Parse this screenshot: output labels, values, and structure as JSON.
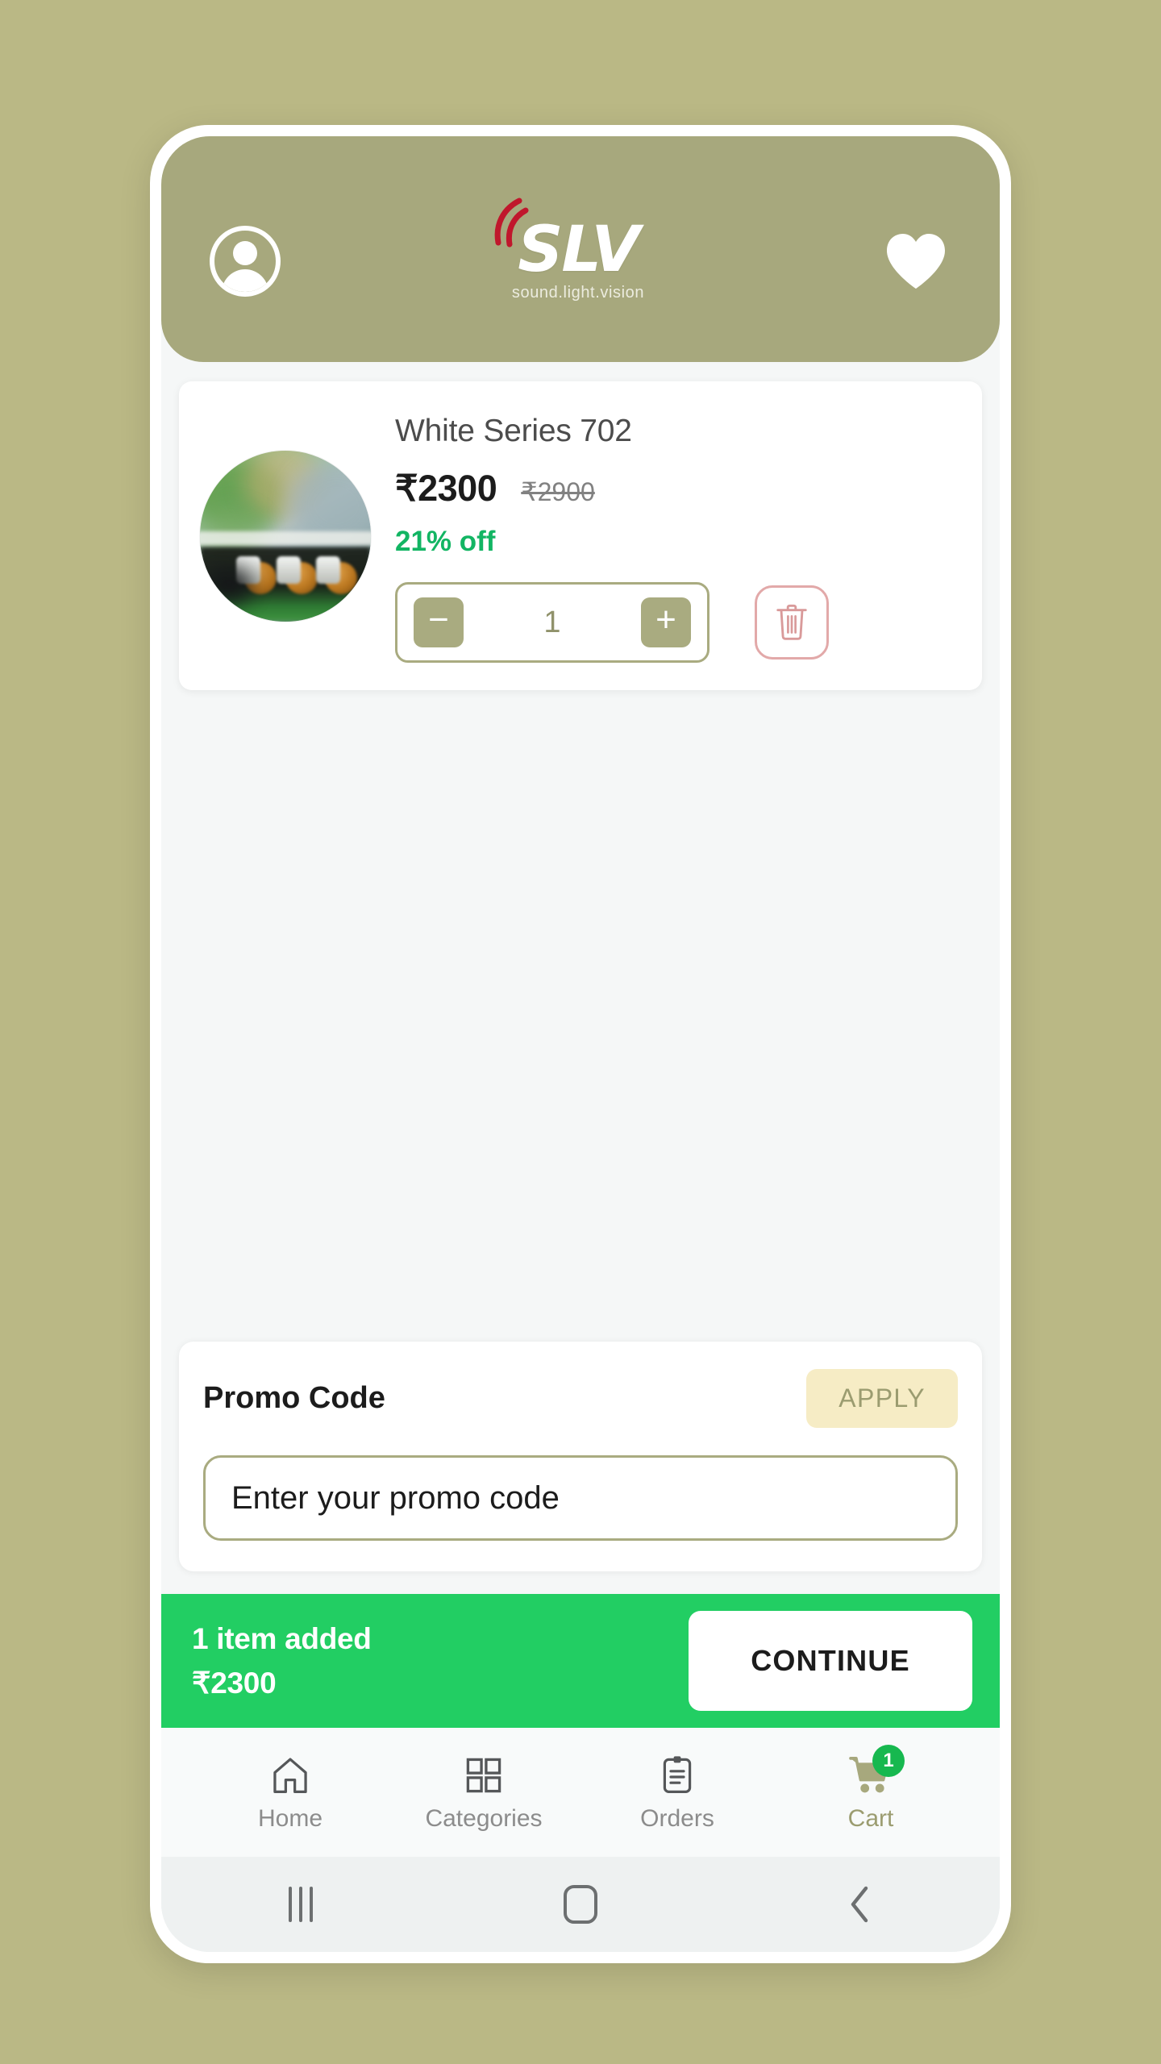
{
  "theme": {
    "page_background": "#bab885",
    "header_olive": "#a7a87d",
    "accent_green": "#22ce63",
    "discount_green": "#12b563",
    "apply_cream": "#f6ecc5",
    "delete_red": "#e2a9a9",
    "screen_background": "#f5f7f7"
  },
  "header": {
    "profile_icon": "profile-icon",
    "logo_text": "SLV",
    "logo_tagline": "sound.light.vision",
    "wishlist_icon": "heart-icon"
  },
  "cart": {
    "product": {
      "image_alt": "product-thumbnail",
      "name": "White Series 702",
      "price_current": "₹2300",
      "price_original": "₹2900",
      "discount": "21% off",
      "quantity": "1",
      "decrease_label": "−",
      "increase_label": "+",
      "delete_icon": "trash-icon"
    }
  },
  "promo": {
    "title": "Promo Code",
    "apply_label": "APPLY",
    "input_value": "",
    "input_placeholder": "Enter your promo code"
  },
  "summary": {
    "items_text": "1 item added",
    "total": "₹2300",
    "continue_label": "CONTINUE"
  },
  "bottom_nav": {
    "items": [
      {
        "label": "Home",
        "icon": "home-icon",
        "active": false
      },
      {
        "label": "Categories",
        "icon": "grid-icon",
        "active": false
      },
      {
        "label": "Orders",
        "icon": "clipboard-icon",
        "active": false
      },
      {
        "label": "Cart",
        "icon": "cart-icon",
        "active": true,
        "badge": "1"
      }
    ]
  },
  "system_nav": {
    "recents": "recents-icon",
    "home": "home-square-icon",
    "back": "back-chevron-icon"
  }
}
